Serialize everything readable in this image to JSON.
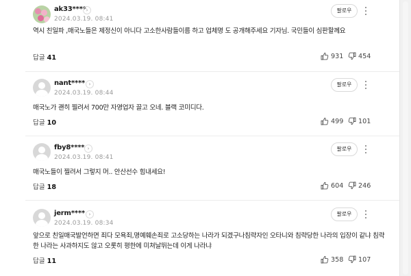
{
  "comments": [
    {
      "author": "ak33****",
      "date": "2024.03.19. 08:41",
      "follow_label": "팔로우",
      "text": "역시 친일파 ,매국노들은 제정신이 아니다 고소한사람들이름 하고 업체명 도 공개해주세요 기자님. 국민들이 심판할께요",
      "reply_label": "답글",
      "reply_count": "41",
      "likes": "931",
      "dislikes": "454"
    },
    {
      "author": "nant****",
      "date": "2024.03.19. 08:44",
      "follow_label": "팔로우",
      "text": "매국노가 괜히 찔려서 700만 자영업자 끌고 오네. 블랙 코미디다.",
      "reply_label": "답글",
      "reply_count": "10",
      "likes": "499",
      "dislikes": "101"
    },
    {
      "author": "fby8****",
      "date": "2024.03.19. 08:41",
      "follow_label": "팔로우",
      "text": "매국노들이 찔려서 그렇지 머.. 안산선수 힘내세요!",
      "reply_label": "답글",
      "reply_count": "18",
      "likes": "604",
      "dislikes": "246"
    },
    {
      "author": "jerm****",
      "date": "2024.03.19. 08:34",
      "follow_label": "팔로우",
      "text": "앞으로 친일매국발언하면 죄다 모욕죄,명예훼손죄로 고소당하는 나라가 되겠구나침략자인 오타니와 침략당한 나라의 입장이 같냐 침략한 나라는 사과하지도 않고 오롯히 평한에 미쳐날뛰는데 이게 나라냐",
      "reply_label": "답글",
      "reply_count": "11",
      "likes": "358",
      "dislikes": "107"
    }
  ]
}
